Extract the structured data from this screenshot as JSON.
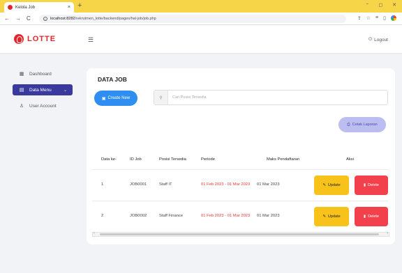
{
  "browser": {
    "tab_title": "Kelola Job",
    "tab_close": "×",
    "new_tab": "+",
    "url_host": "localhost:8282",
    "url_path": "/rekrutmen_lotte/backend/pages/hal-job/job.php",
    "nav": {
      "back": "←",
      "forward": "→",
      "reload": "C"
    },
    "window": {
      "minimize": "−",
      "maximize": "◻",
      "close": "✕"
    }
  },
  "header": {
    "logo_text": "LOTTE",
    "menu_icon": "☰",
    "logout_label": "Logout",
    "logout_icon": "⏻"
  },
  "sidebar": {
    "items": [
      {
        "label": "Dashboard",
        "icon": "▦",
        "active": false
      },
      {
        "label": "Data Menu",
        "icon": "▤",
        "active": true,
        "chevron": "⌄"
      },
      {
        "label": "User Account",
        "icon": "♙",
        "active": false
      }
    ]
  },
  "main": {
    "title": "DATA JOB",
    "create_label": "Create New",
    "create_icon": "▣",
    "search_placeholder": "Cari Posisi Tersedia",
    "search_icon": "⚲",
    "print_label": "Cetak Laporan",
    "print_icon": "⎙",
    "table": {
      "headers": [
        "Data ke-",
        "ID Job",
        "Posisi Tersedia",
        "Periode",
        "Maks Pendaftaran",
        "Aksi"
      ],
      "rows": [
        {
          "no": "1",
          "id": "JOB0001",
          "posisi": "Staff IT",
          "periode": "01 Feb 2023 - 01 Mar 2023",
          "maks": "01 Mar 2023"
        },
        {
          "no": "2",
          "id": "JOB0002",
          "posisi": "Staff Finance",
          "periode": "01 Feb 2023 - 01 Mar 2023",
          "maks": "01 Mar 2023"
        }
      ],
      "update_label": "Update",
      "update_icon": "✎",
      "delete_label": "Delete",
      "delete_icon": "▮"
    }
  },
  "colors": {
    "accent": "#3a3a9e",
    "brand_red": "#e3262e",
    "create_blue": "#2f8ff0",
    "update_yellow": "#f7c21a",
    "delete_red": "#f2414c"
  }
}
